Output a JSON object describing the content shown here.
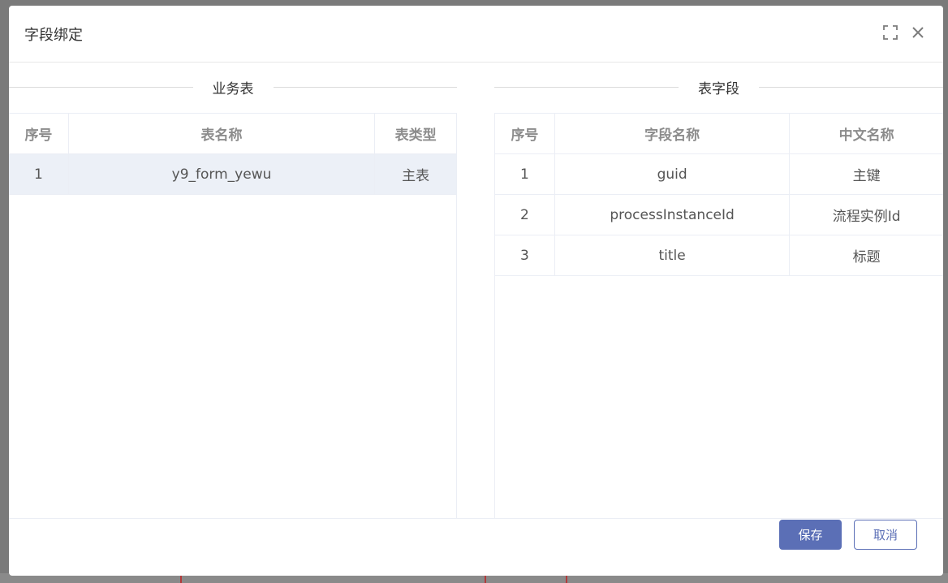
{
  "dialog": {
    "title": "字段绑定"
  },
  "left_panel": {
    "heading": "业务表",
    "columns": [
      "序号",
      "表名称",
      "表类型"
    ],
    "rows": [
      {
        "index": "1",
        "name": "y9_form_yewu",
        "type": "主表"
      }
    ]
  },
  "right_panel": {
    "heading": "表字段",
    "columns": [
      "序号",
      "字段名称",
      "中文名称"
    ],
    "rows": [
      {
        "index": "1",
        "field": "guid",
        "cn": "主键"
      },
      {
        "index": "2",
        "field": "processInstanceId",
        "cn": "流程实例Id"
      },
      {
        "index": "3",
        "field": "title",
        "cn": "标题"
      }
    ]
  },
  "footer": {
    "save_label": "保存",
    "cancel_label": "取消"
  },
  "icons": {
    "fullscreen": "fullscreen-icon",
    "close": "close-icon"
  },
  "colors": {
    "primary": "#5b6fb6",
    "selected_row": "#ecf0f7"
  }
}
